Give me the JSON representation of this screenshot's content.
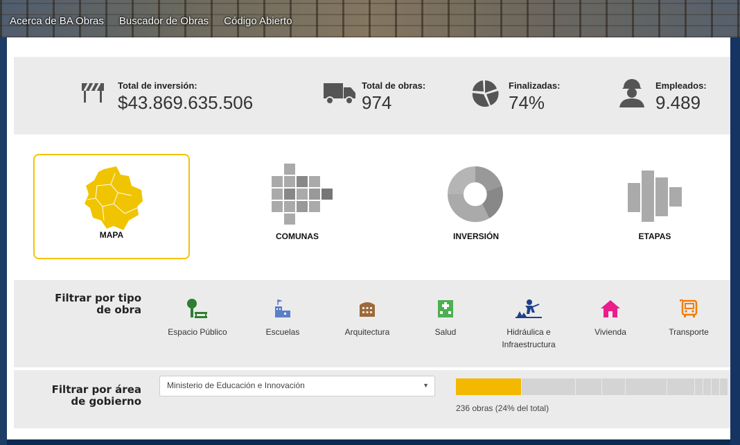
{
  "nav": {
    "items": [
      "Acerca de BA Obras",
      "Buscador de Obras",
      "Código Abierto"
    ]
  },
  "stats": [
    {
      "label": "Total de inversión:",
      "value": "$43.869.635.506",
      "icon": "roadblock-icon"
    },
    {
      "label": "Total de obras:",
      "value": "974",
      "icon": "truck-icon"
    },
    {
      "label": "Finalizadas:",
      "value": "74%",
      "icon": "pie-chart-icon"
    },
    {
      "label": "Empleados:",
      "value": "9.489",
      "icon": "worker-icon"
    }
  ],
  "views": {
    "selected": "MAPA",
    "items": [
      {
        "label": "MAPA",
        "icon": "city-map-icon"
      },
      {
        "label": "COMUNAS",
        "icon": "grid-blocks-icon"
      },
      {
        "label": "INVERSIÓN",
        "icon": "donut-chart-icon"
      },
      {
        "label": "ETAPAS",
        "icon": "stage-bars-icon"
      }
    ]
  },
  "filter_type": {
    "title_line1": "Filtrar por tipo",
    "title_line2": "de obra",
    "items": [
      {
        "label": "Espacio Público",
        "label2": "",
        "icon": "park-bench-icon",
        "color": "#2e7d32"
      },
      {
        "label": "Escuelas",
        "label2": "",
        "icon": "school-icon",
        "color": "#5b7fc7"
      },
      {
        "label": "Arquitectura",
        "label2": "",
        "icon": "building-icon",
        "color": "#9a6a3c"
      },
      {
        "label": "Salud",
        "label2": "",
        "icon": "hospital-icon",
        "color": "#4caf50"
      },
      {
        "label": "Hidráulica e",
        "label2": "Infraestructura",
        "icon": "worker-digging-icon",
        "color": "#1f3f8a"
      },
      {
        "label": "Vivienda",
        "label2": "",
        "icon": "house-icon",
        "color": "#e91e8c"
      },
      {
        "label": "Transporte",
        "label2": "",
        "icon": "bus-icon",
        "color": "#f57c00"
      }
    ]
  },
  "filter_area": {
    "title_line1": "Filtrar por área",
    "title_line2": "de gobierno",
    "selected_option": "Ministerio de Educación e Innovación",
    "caption": "236 obras (24% del total)",
    "bar_fraction": 0.24,
    "accent_color": "#f5b800"
  }
}
